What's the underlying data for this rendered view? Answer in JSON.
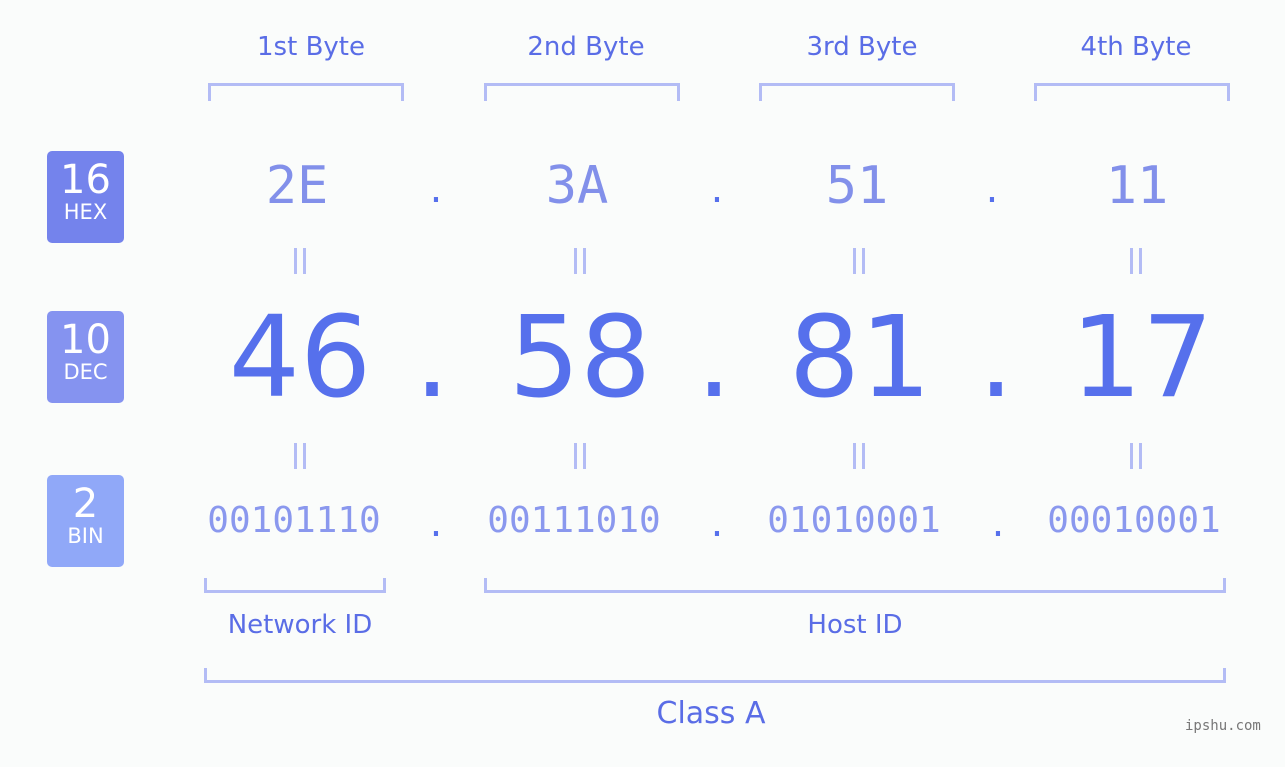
{
  "bytes": [
    {
      "header": "1st Byte",
      "hex": "2E",
      "dec": "46",
      "bin": "00101110"
    },
    {
      "header": "2nd Byte",
      "hex": "3A",
      "dec": "58",
      "bin": "00111010"
    },
    {
      "header": "3rd Byte",
      "hex": "51",
      "dec": "81",
      "bin": "01010001"
    },
    {
      "header": "4th Byte",
      "hex": "11",
      "dec": "17",
      "bin": "00010001"
    }
  ],
  "separator": ".",
  "badges": {
    "hex": {
      "number": "16",
      "label": "HEX",
      "color": "#7483ec"
    },
    "dec": {
      "number": "10",
      "label": "DEC",
      "color": "#8593f0"
    },
    "bin": {
      "number": "2",
      "label": "BIN",
      "color": "#90a8f8"
    }
  },
  "labels": {
    "network_id": "Network ID",
    "host_id": "Host ID",
    "class": "Class A"
  },
  "watermark": "ipshu.com"
}
